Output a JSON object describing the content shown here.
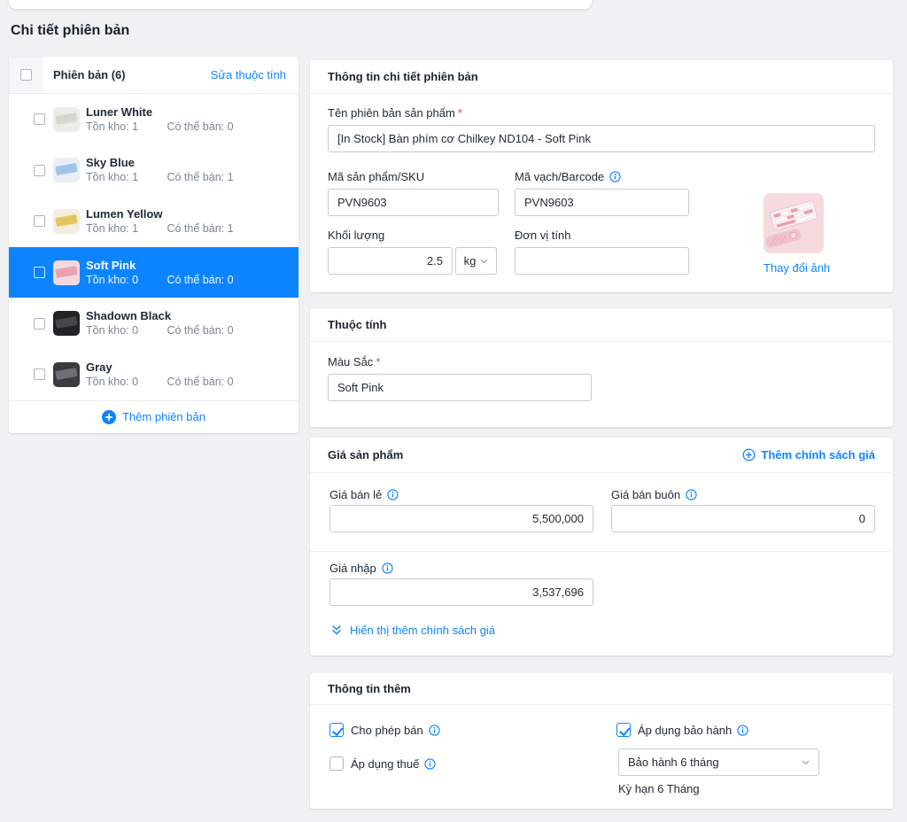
{
  "page": {
    "title": "Chi tiết phiên bản",
    "required_mark": "*"
  },
  "theme": {
    "accent_blue": "#0c84ff",
    "selected_row_bg": "#0c84ff",
    "page_bg": "#eff1f2",
    "card_bg": "#ffffff",
    "danger_red": "#e5484d"
  },
  "variant_list": {
    "header_title": "Phiên bản (6)",
    "edit_link": "Sửa thuộc tính",
    "add_link": "Thêm phiên bản",
    "items": [
      {
        "name": "Luner White",
        "stock": "Tồn kho: 1",
        "sellable": "Có thể bán: 0",
        "selected": false,
        "thumb_bg": "#ecece9",
        "thumb_key": "#d8d6d0"
      },
      {
        "name": "Sky Blue",
        "stock": "Tồn kho: 1",
        "sellable": "Có thể bán: 1",
        "selected": false,
        "thumb_bg": "#e9eff6",
        "thumb_key": "#a3c4e9"
      },
      {
        "name": "Lumen Yellow",
        "stock": "Tồn kho: 1",
        "sellable": "Có thể bán: 1",
        "selected": false,
        "thumb_bg": "#f3eedd",
        "thumb_key": "#e3c55f"
      },
      {
        "name": "Soft Pink",
        "stock": "Tồn kho: 0",
        "sellable": "Có thể bán: 0",
        "selected": true,
        "thumb_bg": "#f3d9dd",
        "thumb_key": "#e8a3b1"
      },
      {
        "name": "Shadown Black",
        "stock": "Tồn kho: 0",
        "sellable": "Có thể bán: 0",
        "selected": false,
        "thumb_bg": "#232325",
        "thumb_key": "#47474b"
      },
      {
        "name": "Gray",
        "stock": "Tồn kho: 0",
        "sellable": "Có thể bán: 0",
        "selected": false,
        "thumb_bg": "#393b3d",
        "thumb_key": "#6c6f73"
      }
    ]
  },
  "details": {
    "title": "Thông tin chi tiết phiên bản",
    "name_label": "Tên phiên bản sản phẩm",
    "name_value": "[In Stock] Bàn phím cơ Chilkey ND104 - Soft Pink",
    "sku_label": "Mã sản phẩm/SKU",
    "sku_value": "PVN9603",
    "barcode_label": "Mã vạch/Barcode",
    "barcode_value": "PVN9603",
    "weight_label": "Khối lượng",
    "weight_value": "2.5",
    "weight_unit": "kg",
    "unit_label": "Đơn vị tính",
    "unit_value": "",
    "change_image_link": "Thay đổi ảnh"
  },
  "attributes": {
    "title": "Thuộc tính",
    "color_label": "Màu Sắc",
    "color_value": "Soft Pink"
  },
  "pricing": {
    "title": "Giá sản phẩm",
    "add_policy_link": "Thêm chính sách giá",
    "retail_label": "Giá bán lẻ",
    "retail_value": "5,500,000",
    "wholesale_label": "Giá bán buôn",
    "wholesale_value": "0",
    "import_label": "Giá nhập",
    "import_value": "3,537,696",
    "show_more_link": "Hiển thị thêm chính sách giá"
  },
  "extra": {
    "title": "Thông tin thêm",
    "allow_sale": {
      "label": "Cho phép bán",
      "checked": true
    },
    "apply_tax": {
      "label": "Áp dụng thuế",
      "checked": false
    },
    "warranty": {
      "label": "Áp dụng bảo hành",
      "checked": true
    },
    "warranty_value": "Bảo hành 6 tháng",
    "warranty_note": "Kỳ hạn 6 Tháng"
  }
}
